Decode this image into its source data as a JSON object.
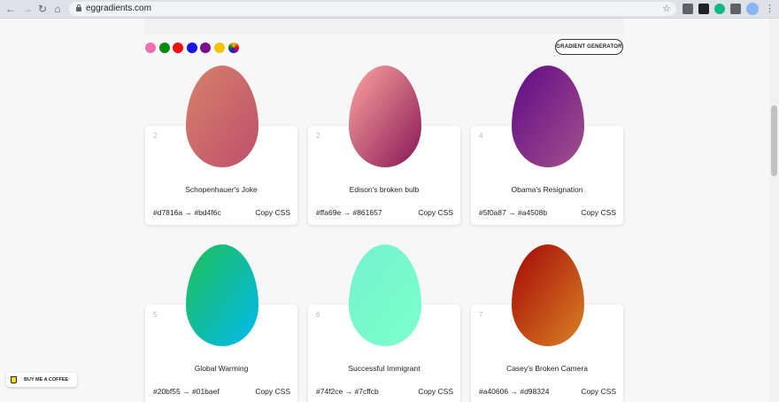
{
  "browser": {
    "url": "eggradients.com",
    "back": "←",
    "forward": "→",
    "reload": "↻",
    "home": "⌂",
    "star": "☆",
    "menu": "⋮"
  },
  "palette": {
    "swatches": [
      {
        "name": "pink",
        "color": "#ee6fb0"
      },
      {
        "name": "green",
        "color": "#0d8a10"
      },
      {
        "name": "red",
        "color": "#ee1111"
      },
      {
        "name": "blue",
        "color": "#1b14e8"
      },
      {
        "name": "purple",
        "color": "#7d0d8c"
      },
      {
        "name": "yellow",
        "color": "#f4c40b"
      },
      {
        "name": "multicolor",
        "color": "conic"
      }
    ]
  },
  "header": {
    "gradient_generator_label": "GRADIENT GENERATOR"
  },
  "cards": [
    {
      "num": "2",
      "name": "Schopenhauer's Joke",
      "from": "#d7816a",
      "to": "#bd4f6c",
      "copy": "Copy CSS",
      "arrow": "→"
    },
    {
      "num": "2",
      "name": "Edison's broken bulb",
      "from": "#ffa69e",
      "to": "#861657",
      "copy": "Copy CSS",
      "arrow": "→"
    },
    {
      "num": "4",
      "name": "Obama's Resignation",
      "from": "#5f0a87",
      "to": "#a4508b",
      "copy": "Copy CSS",
      "arrow": "→"
    },
    {
      "num": "5",
      "name": "Global Warming",
      "from": "#20bf55",
      "to": "#01baef",
      "copy": "Copy CSS",
      "arrow": "→"
    },
    {
      "num": "6",
      "name": "Successful Immigrant",
      "from": "#74f2ce",
      "to": "#7cffcb",
      "copy": "Copy CSS",
      "arrow": "→"
    },
    {
      "num": "7",
      "name": "Casey's Broken Camera",
      "from": "#a40606",
      "to": "#d98324",
      "copy": "Copy CSS",
      "arrow": "→"
    }
  ],
  "coffee": {
    "label": "BUY ME A COFFEE"
  }
}
